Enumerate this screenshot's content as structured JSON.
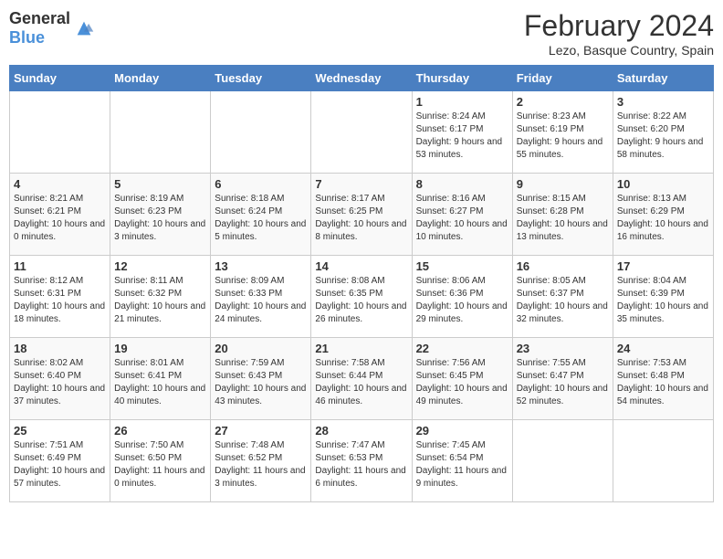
{
  "header": {
    "logo_general": "General",
    "logo_blue": "Blue",
    "title": "February 2024",
    "subtitle": "Lezo, Basque Country, Spain"
  },
  "weekdays": [
    "Sunday",
    "Monday",
    "Tuesday",
    "Wednesday",
    "Thursday",
    "Friday",
    "Saturday"
  ],
  "weeks": [
    [
      {
        "day": "",
        "info": ""
      },
      {
        "day": "",
        "info": ""
      },
      {
        "day": "",
        "info": ""
      },
      {
        "day": "",
        "info": ""
      },
      {
        "day": "1",
        "info": "Sunrise: 8:24 AM\nSunset: 6:17 PM\nDaylight: 9 hours and 53 minutes."
      },
      {
        "day": "2",
        "info": "Sunrise: 8:23 AM\nSunset: 6:19 PM\nDaylight: 9 hours and 55 minutes."
      },
      {
        "day": "3",
        "info": "Sunrise: 8:22 AM\nSunset: 6:20 PM\nDaylight: 9 hours and 58 minutes."
      }
    ],
    [
      {
        "day": "4",
        "info": "Sunrise: 8:21 AM\nSunset: 6:21 PM\nDaylight: 10 hours and 0 minutes."
      },
      {
        "day": "5",
        "info": "Sunrise: 8:19 AM\nSunset: 6:23 PM\nDaylight: 10 hours and 3 minutes."
      },
      {
        "day": "6",
        "info": "Sunrise: 8:18 AM\nSunset: 6:24 PM\nDaylight: 10 hours and 5 minutes."
      },
      {
        "day": "7",
        "info": "Sunrise: 8:17 AM\nSunset: 6:25 PM\nDaylight: 10 hours and 8 minutes."
      },
      {
        "day": "8",
        "info": "Sunrise: 8:16 AM\nSunset: 6:27 PM\nDaylight: 10 hours and 10 minutes."
      },
      {
        "day": "9",
        "info": "Sunrise: 8:15 AM\nSunset: 6:28 PM\nDaylight: 10 hours and 13 minutes."
      },
      {
        "day": "10",
        "info": "Sunrise: 8:13 AM\nSunset: 6:29 PM\nDaylight: 10 hours and 16 minutes."
      }
    ],
    [
      {
        "day": "11",
        "info": "Sunrise: 8:12 AM\nSunset: 6:31 PM\nDaylight: 10 hours and 18 minutes."
      },
      {
        "day": "12",
        "info": "Sunrise: 8:11 AM\nSunset: 6:32 PM\nDaylight: 10 hours and 21 minutes."
      },
      {
        "day": "13",
        "info": "Sunrise: 8:09 AM\nSunset: 6:33 PM\nDaylight: 10 hours and 24 minutes."
      },
      {
        "day": "14",
        "info": "Sunrise: 8:08 AM\nSunset: 6:35 PM\nDaylight: 10 hours and 26 minutes."
      },
      {
        "day": "15",
        "info": "Sunrise: 8:06 AM\nSunset: 6:36 PM\nDaylight: 10 hours and 29 minutes."
      },
      {
        "day": "16",
        "info": "Sunrise: 8:05 AM\nSunset: 6:37 PM\nDaylight: 10 hours and 32 minutes."
      },
      {
        "day": "17",
        "info": "Sunrise: 8:04 AM\nSunset: 6:39 PM\nDaylight: 10 hours and 35 minutes."
      }
    ],
    [
      {
        "day": "18",
        "info": "Sunrise: 8:02 AM\nSunset: 6:40 PM\nDaylight: 10 hours and 37 minutes."
      },
      {
        "day": "19",
        "info": "Sunrise: 8:01 AM\nSunset: 6:41 PM\nDaylight: 10 hours and 40 minutes."
      },
      {
        "day": "20",
        "info": "Sunrise: 7:59 AM\nSunset: 6:43 PM\nDaylight: 10 hours and 43 minutes."
      },
      {
        "day": "21",
        "info": "Sunrise: 7:58 AM\nSunset: 6:44 PM\nDaylight: 10 hours and 46 minutes."
      },
      {
        "day": "22",
        "info": "Sunrise: 7:56 AM\nSunset: 6:45 PM\nDaylight: 10 hours and 49 minutes."
      },
      {
        "day": "23",
        "info": "Sunrise: 7:55 AM\nSunset: 6:47 PM\nDaylight: 10 hours and 52 minutes."
      },
      {
        "day": "24",
        "info": "Sunrise: 7:53 AM\nSunset: 6:48 PM\nDaylight: 10 hours and 54 minutes."
      }
    ],
    [
      {
        "day": "25",
        "info": "Sunrise: 7:51 AM\nSunset: 6:49 PM\nDaylight: 10 hours and 57 minutes."
      },
      {
        "day": "26",
        "info": "Sunrise: 7:50 AM\nSunset: 6:50 PM\nDaylight: 11 hours and 0 minutes."
      },
      {
        "day": "27",
        "info": "Sunrise: 7:48 AM\nSunset: 6:52 PM\nDaylight: 11 hours and 3 minutes."
      },
      {
        "day": "28",
        "info": "Sunrise: 7:47 AM\nSunset: 6:53 PM\nDaylight: 11 hours and 6 minutes."
      },
      {
        "day": "29",
        "info": "Sunrise: 7:45 AM\nSunset: 6:54 PM\nDaylight: 11 hours and 9 minutes."
      },
      {
        "day": "",
        "info": ""
      },
      {
        "day": "",
        "info": ""
      }
    ]
  ]
}
